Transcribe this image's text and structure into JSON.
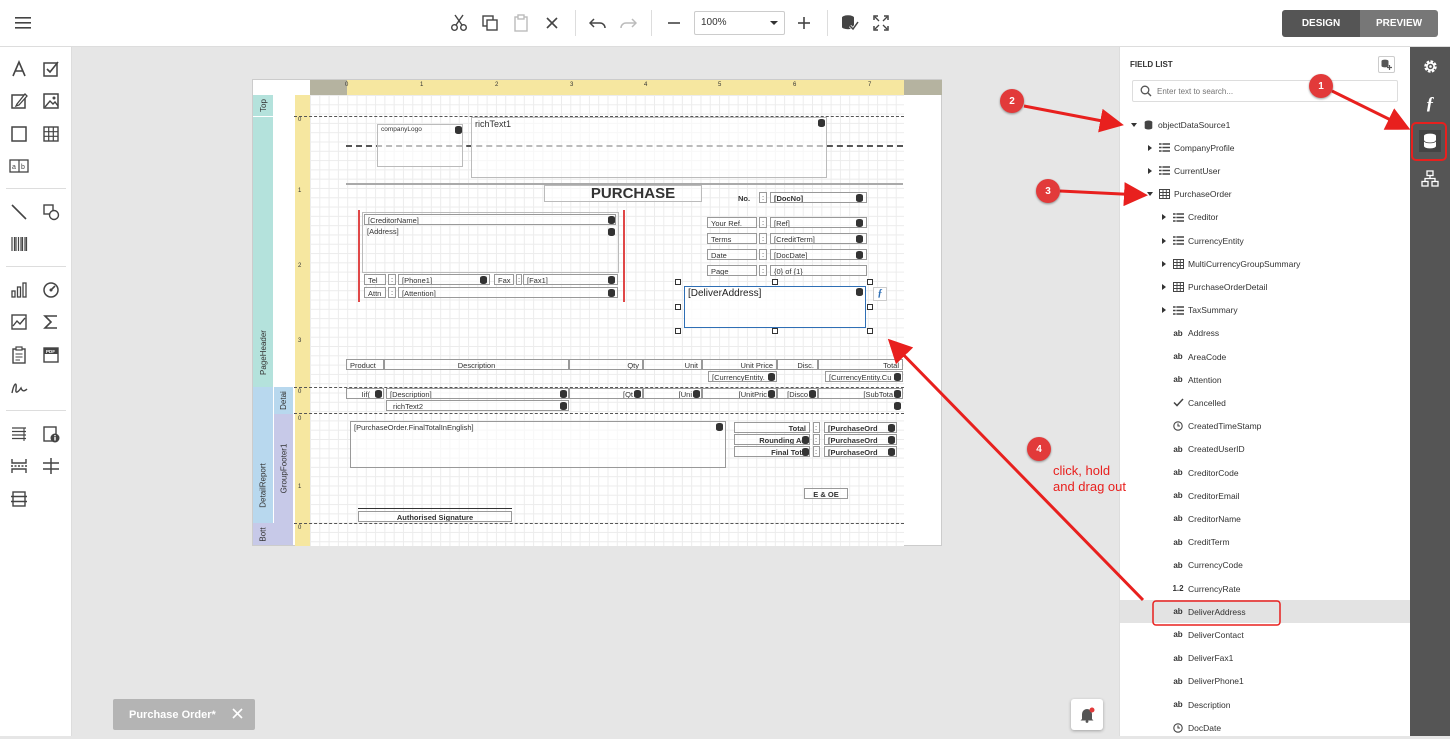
{
  "toolbar": {
    "zoom_value": "100%",
    "design_label": "DESIGN",
    "preview_label": "PREVIEW"
  },
  "colors": {
    "band_teal": "#b4e2dc",
    "band_blue": "#b8d8ee",
    "band_lavender": "#c7c9e8",
    "ruler_yellow": "#f6e7a0",
    "callout_red": "#e23a3a",
    "mode_active": "#555555",
    "mode_inactive": "#777777",
    "selected_field": "#2f6fb5"
  },
  "bands": {
    "top": "Top",
    "page_header": "PageHeader",
    "detail": "Detai",
    "detail_report": "DetailReport",
    "group_footer": "GroupFooter1",
    "bottom": "Bott"
  },
  "ruler_marks": [
    "0",
    "1",
    "2",
    "3",
    "4",
    "5",
    "6",
    "7"
  ],
  "ruler_v_marks": [
    "0",
    "1",
    "2",
    "3"
  ],
  "ruler_v_marks2": [
    "0",
    "0",
    "1",
    "0"
  ],
  "report": {
    "company_logo": "companyLogo",
    "rich_text1": "richText1",
    "title": "PURCHASE",
    "no_label": "No.",
    "no_colon": ":",
    "doc_no": "[DocNo]",
    "creditor_name": "[CreditorName]",
    "address": "[Address]",
    "tel_label": "Tel",
    "phone1": "[Phone1]",
    "fax_label": "Fax",
    "fax1": "[Fax1]",
    "attn_label": "Attn",
    "attention": "[Attention]",
    "colon": ":",
    "your_ref_label": "Your Ref.",
    "ref": "[Ref]",
    "terms_label": "Terms",
    "credit_term": "[CreditTerm]",
    "date_label": "Date",
    "doc_date": "[DocDate]",
    "page_label": "Page",
    "page_value": "{0} of {1}",
    "deliver_address": "[DeliverAddress]",
    "col_product": "Product",
    "col_description": "Description",
    "col_qty": "Qty",
    "col_unit": "Unit",
    "col_unit_price": "Unit Price",
    "col_disc": "Disc.",
    "col_total": "Total",
    "currency_entity1": "[CurrencyEntity.",
    "currency_entity2": "[CurrencyEntity.Cu",
    "detail_iif": "Iif(",
    "detail_description": "[Description]",
    "detail_qty": "[Qt",
    "detail_unit": "[Uni",
    "detail_unitprice": "[UnitPric",
    "detail_disc": "[Disco",
    "detail_subtotal": "[SubTota",
    "rich_text2": "richText2",
    "final_total_english": "[PurchaseOrder.FinalTotalInEnglish]",
    "total_label": "Total",
    "rounding_label": "Rounding Ad",
    "final_total_label": "Final Tota",
    "po_value1": "[PurchaseOrd",
    "po_value2": "[PurchaseOrd",
    "po_value3": "[PurchaseOrd",
    "eoe": "E & OE",
    "signature": "Authorised Signature"
  },
  "field_list": {
    "title": "FIELD LIST",
    "search_placeholder": "Enter text to search...",
    "items": [
      {
        "label": "objectDataSource1",
        "icon": "database-icon",
        "level": 0,
        "expander": "down"
      },
      {
        "label": "CompanyProfile",
        "icon": "list-icon",
        "level": 1,
        "expander": "right"
      },
      {
        "label": "CurrentUser",
        "icon": "list-icon",
        "level": 1,
        "expander": "right"
      },
      {
        "label": "PurchaseOrder",
        "icon": "table-icon",
        "level": 1,
        "expander": "down"
      },
      {
        "label": "Creditor",
        "icon": "list-icon",
        "level": 2,
        "expander": "right"
      },
      {
        "label": "CurrencyEntity",
        "icon": "list-icon",
        "level": 2,
        "expander": "right"
      },
      {
        "label": "MultiCurrencyGroupSummary",
        "icon": "table-icon",
        "level": 2,
        "expander": "right"
      },
      {
        "label": "PurchaseOrderDetail",
        "icon": "table-icon",
        "level": 2,
        "expander": "right"
      },
      {
        "label": "TaxSummary",
        "icon": "list-icon",
        "level": 2,
        "expander": "right"
      },
      {
        "label": "Address",
        "icon": "ab",
        "level": 2,
        "expander": ""
      },
      {
        "label": "AreaCode",
        "icon": "ab",
        "level": 2,
        "expander": ""
      },
      {
        "label": "Attention",
        "icon": "ab",
        "level": 2,
        "expander": ""
      },
      {
        "label": "Cancelled",
        "icon": "check-icon",
        "level": 2,
        "expander": ""
      },
      {
        "label": "CreatedTimeStamp",
        "icon": "clock-icon",
        "level": 2,
        "expander": ""
      },
      {
        "label": "CreatedUserID",
        "icon": "ab",
        "level": 2,
        "expander": ""
      },
      {
        "label": "CreditorCode",
        "icon": "ab",
        "level": 2,
        "expander": ""
      },
      {
        "label": "CreditorEmail",
        "icon": "ab",
        "level": 2,
        "expander": ""
      },
      {
        "label": "CreditorName",
        "icon": "ab",
        "level": 2,
        "expander": ""
      },
      {
        "label": "CreditTerm",
        "icon": "ab",
        "level": 2,
        "expander": ""
      },
      {
        "label": "CurrencyCode",
        "icon": "ab",
        "level": 2,
        "expander": ""
      },
      {
        "label": "CurrencyRate",
        "icon": "1.2",
        "level": 2,
        "expander": ""
      },
      {
        "label": "DeliverAddress",
        "icon": "ab",
        "level": 2,
        "expander": "",
        "selected": true
      },
      {
        "label": "DeliverContact",
        "icon": "ab",
        "level": 2,
        "expander": ""
      },
      {
        "label": "DeliverFax1",
        "icon": "ab",
        "level": 2,
        "expander": ""
      },
      {
        "label": "DeliverPhone1",
        "icon": "ab",
        "level": 2,
        "expander": ""
      },
      {
        "label": "Description",
        "icon": "ab",
        "level": 2,
        "expander": ""
      },
      {
        "label": "DocDate",
        "icon": "clock-icon",
        "level": 2,
        "expander": ""
      }
    ]
  },
  "annotations": {
    "c1": "1",
    "c2": "2",
    "c3": "3",
    "c4": "4",
    "instruction_line1": "click, hold",
    "instruction_line2": "and drag out"
  },
  "doc_tab": {
    "label": "Purchase Order*"
  }
}
